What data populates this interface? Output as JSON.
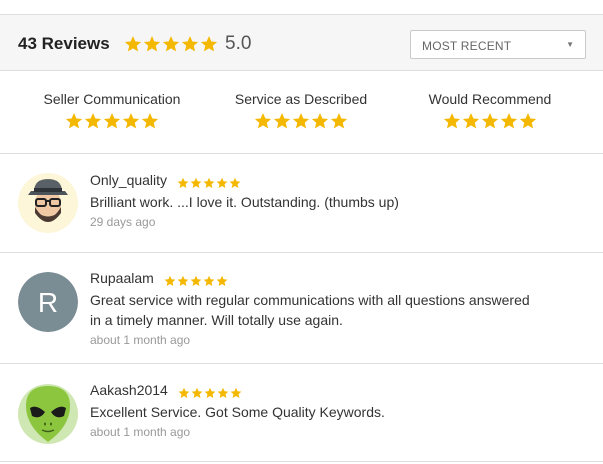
{
  "header": {
    "review_count_label": "43 Reviews",
    "average_score": "5.0",
    "average_stars": 5,
    "sort": {
      "selected": "MOST RECENT"
    }
  },
  "breakdown": [
    {
      "label": "Seller Communication",
      "stars": 5
    },
    {
      "label": "Service as Described",
      "stars": 5
    },
    {
      "label": "Would Recommend",
      "stars": 5
    }
  ],
  "reviews": [
    {
      "username": "Only_quality",
      "stars": 5,
      "text": "Brilliant work. ...I love it. Outstanding. (thumbs up)",
      "time": "29 days ago",
      "avatar_icon": "hipster-face-avatar"
    },
    {
      "username": "Rupaalam",
      "stars": 5,
      "text_line1": "Great service with regular communications with all questions answered",
      "text_line2": "in a timely manner. Will totally use again.",
      "time": "about 1 month ago",
      "avatar_letter": "R"
    },
    {
      "username": "Aakash2014",
      "stars": 5,
      "text": "Excellent Service. Got Some Quality Keywords.",
      "time": "about 1 month ago",
      "avatar_icon": "alien-face-avatar"
    }
  ],
  "colors": {
    "star": "#f5b800",
    "avatar_letter_bg": "#7a8c94"
  }
}
